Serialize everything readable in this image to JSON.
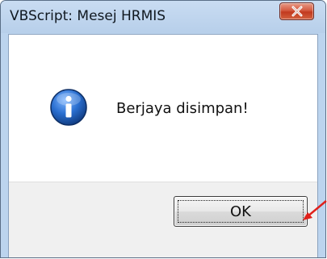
{
  "window": {
    "title": "VBScript: Mesej HRMIS"
  },
  "titlebar": {
    "close_icon": "close-icon"
  },
  "dialog": {
    "icon": "info-icon",
    "message": "Berjaya disimpan!",
    "ok_label": "OK"
  },
  "annotation": {
    "icon": "red-arrow-icon",
    "color": "#e0201a"
  },
  "colors": {
    "titlebar": "#bcd4ee",
    "close_button": "#c9442a",
    "info_icon": "#1e63c4",
    "footer": "#f0f0f0"
  }
}
